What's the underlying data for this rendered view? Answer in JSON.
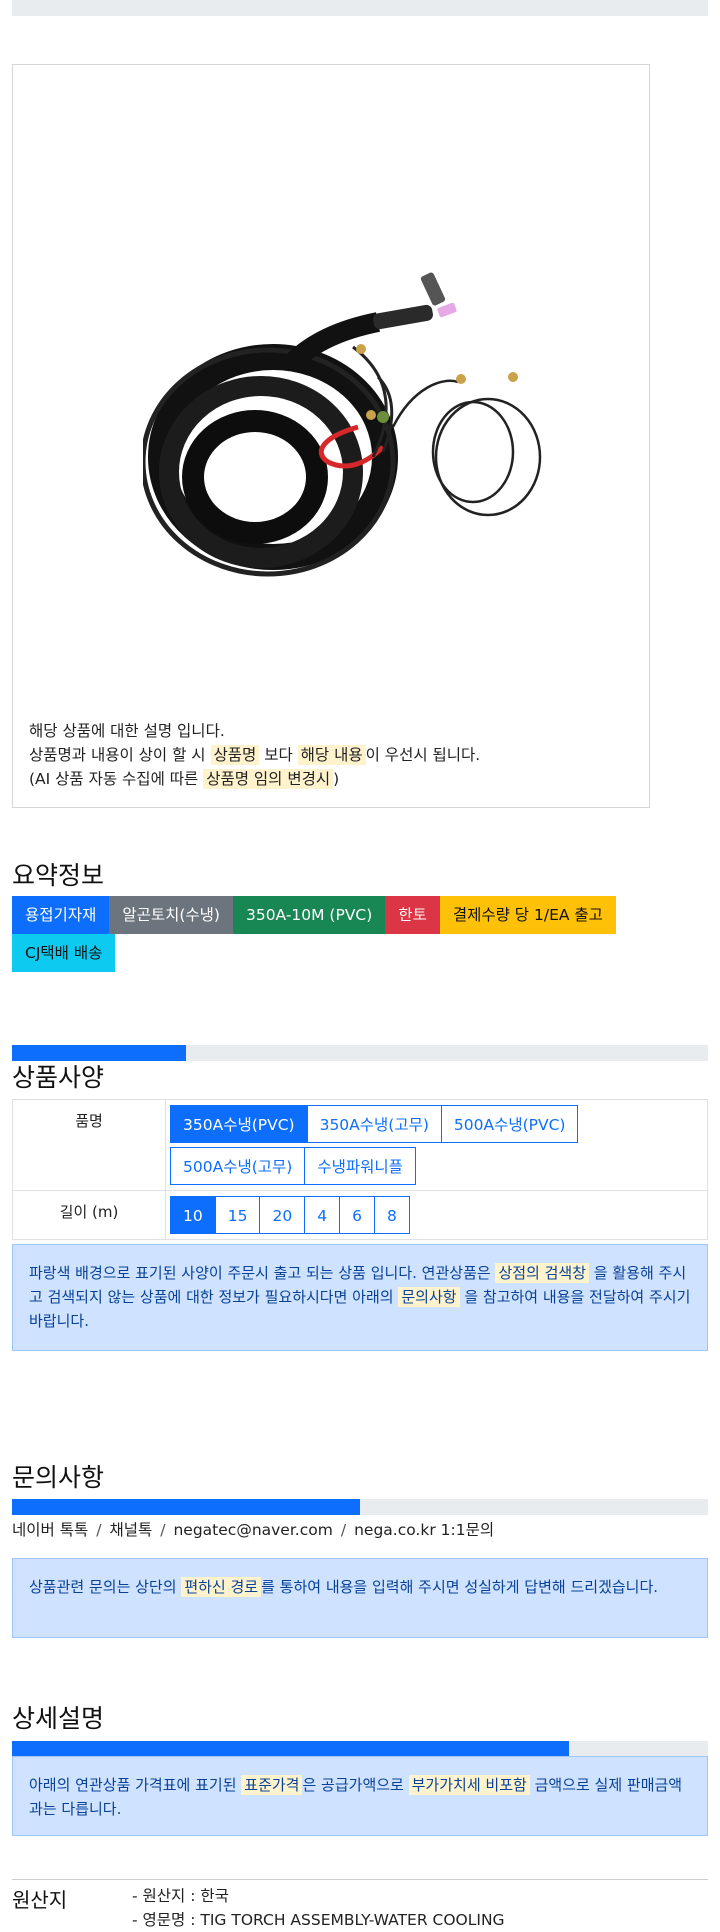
{
  "product_description": {
    "line1": "해당 상품에 대한 설명 입니다.",
    "line2_a": "상품명과 내용이 상이 할 시 ",
    "line2_hl1": "상품명",
    "line2_b": " 보다 ",
    "line2_hl2": "해당 내용",
    "line2_c": "이 우선시 됩니다.",
    "line3_a": "(AI 상품 자동 수집에 따른 ",
    "line3_hl": "상품명 임의 변경시",
    "line3_b": ")"
  },
  "summary": {
    "title": "요약정보",
    "badges": [
      {
        "label": "용접기자재",
        "color": "#0d6efd"
      },
      {
        "label": "알곤토치(수냉)",
        "color": "#6c757d"
      },
      {
        "label": "350A-10M (PVC)",
        "color": "#198754"
      },
      {
        "label": "한토",
        "color": "#dc3545"
      },
      {
        "label": "결제수량 당 1/EA 출고",
        "color": "#ffc107"
      },
      {
        "label": "CJ택배 배송",
        "color": "#0dcaf0"
      }
    ]
  },
  "spec": {
    "title": "상품사양",
    "progress": 0.25,
    "rows": [
      {
        "header": "품명",
        "options": [
          "350A수냉(PVC)",
          "350A수냉(고무)",
          "500A수냉(PVC)",
          "500A수냉(고무)",
          "수냉파워니플"
        ],
        "selected": "350A수냉(PVC)"
      },
      {
        "header": "길이 (m)",
        "options": [
          "10",
          "15",
          "20",
          "4",
          "6",
          "8"
        ],
        "selected": "10"
      }
    ],
    "notice_a": "파랑색 배경으로 표기된 사양이 주문시 출고 되는 상품 입니다. 연관상품은 ",
    "notice_hl1": "상점의 검색창",
    "notice_b": " 을 활용해 주시고 검색되지 않는 상품에 대한 정보가 필요하시다면 아래의 ",
    "notice_hl2": "문의사항",
    "notice_c": " 을 참고하여 내용을 전달하여 주시기 바랍니다."
  },
  "inquiry": {
    "title": "문의사항",
    "progress": 0.5,
    "contacts": [
      "네이버 톡톡",
      "채널톡",
      "negatec@naver.com",
      "nega.co.kr 1:1문의"
    ],
    "separator": "/",
    "notice_a": "상품관련 문의는 상단의 ",
    "notice_hl": "편하신 경로",
    "notice_b": "를 통하여 내용을 입력해 주시면 성실하게 답변해 드리겠습니다."
  },
  "detail": {
    "title": "상세설명",
    "progress": 0.8,
    "notice_a": "아래의 연관상품 가격표에 표기된 ",
    "notice_hl1": "표준가격",
    "notice_b": "은 공급가액으로 ",
    "notice_hl2": "부가가치세 비포함",
    "notice_c": " 금액으로 실제 판매금액과는 다릅니다."
  },
  "origin": {
    "title": "원산지",
    "items": [
      "- 원산지 : 한국",
      "- 영문명 : TIG TORCH ASSEMBLY-WATER COOLING"
    ]
  }
}
